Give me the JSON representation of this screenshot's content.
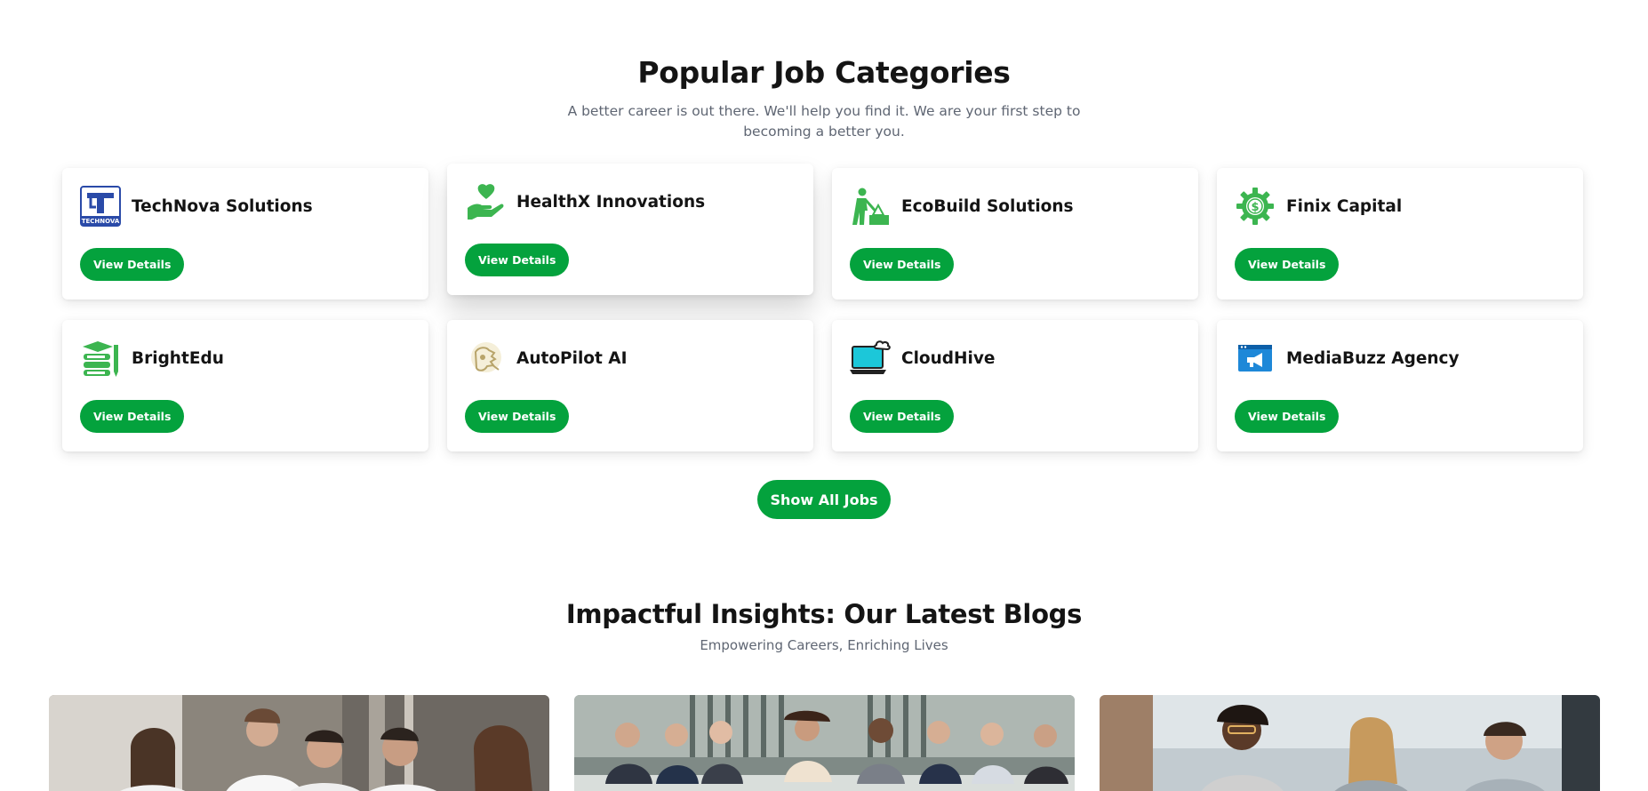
{
  "categories": {
    "title": "Popular Job Categories",
    "subtitle": "A better career is out there. We'll help you find it. We are your first step to becoming a better you.",
    "cards": [
      {
        "company": "TechNova Solutions",
        "button": "View Details",
        "icon": "technova-logo"
      },
      {
        "company": "HealthX Innovations",
        "button": "View Details",
        "icon": "heart-hand-icon"
      },
      {
        "company": "EcoBuild Solutions",
        "button": "View Details",
        "icon": "construction-worker-icon"
      },
      {
        "company": "Finix Capital",
        "button": "View Details",
        "icon": "dollar-gear-icon"
      },
      {
        "company": "BrightEdu",
        "button": "View Details",
        "icon": "books-pencil-icon"
      },
      {
        "company": "AutoPilot AI",
        "button": "View Details",
        "icon": "robot-hand-icon"
      },
      {
        "company": "CloudHive",
        "button": "View Details",
        "icon": "cloud-laptop-icon"
      },
      {
        "company": "MediaBuzz Agency",
        "button": "View Details",
        "icon": "megaphone-icon"
      }
    ],
    "show_all_label": "Show All Jobs",
    "logo_text": "TECHNOVA"
  },
  "blogs": {
    "title": "Impactful Insights: Our Latest Blogs",
    "subtitle": "Empowering Careers, Enriching Lives"
  },
  "colors": {
    "accent": "#04a23d",
    "icon_green": "#3cb550"
  }
}
